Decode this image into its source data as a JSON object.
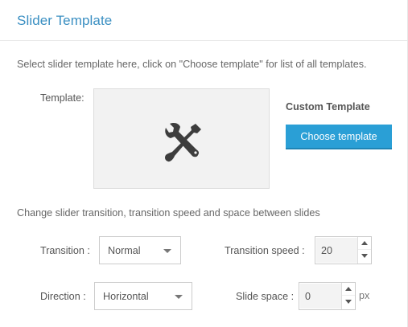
{
  "header": {
    "title": "Slider Template"
  },
  "intro_text": "Select slider template here, click on \"Choose template\" for list of all templates.",
  "template": {
    "label": "Template:",
    "preview_icon": "tools-wrench-screwdriver-icon",
    "custom_label": "Custom Template",
    "choose_button": "Choose template"
  },
  "transition_intro": "Change slider transition, transition speed and space between slides",
  "fields": {
    "transition": {
      "label": "Transition :",
      "value": "Normal"
    },
    "transition_speed": {
      "label": "Transition speed :",
      "value": "20"
    },
    "direction": {
      "label": "Direction :",
      "value": "Horizontal"
    },
    "slide_space": {
      "label": "Slide space :",
      "value": "0",
      "unit": "px"
    }
  },
  "colors": {
    "accent": "#2a9fd6",
    "title": "#3a8fc2"
  }
}
